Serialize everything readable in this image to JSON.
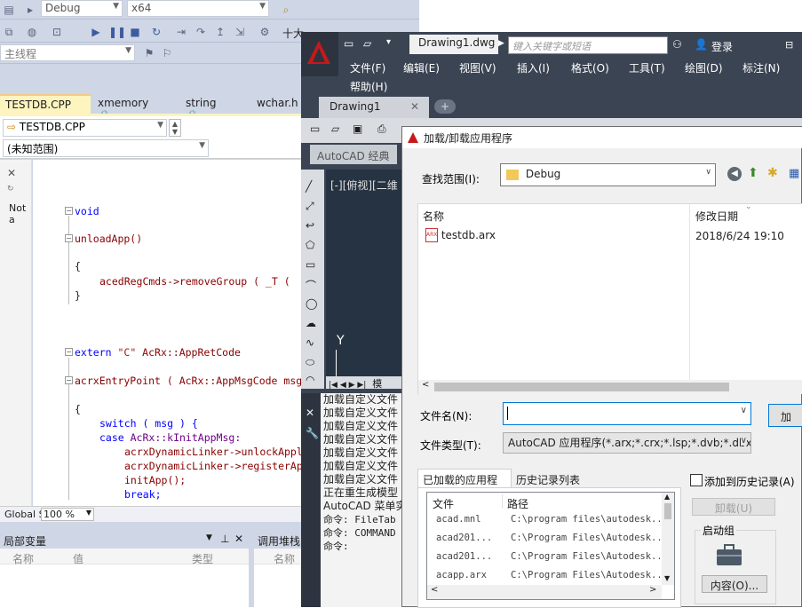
{
  "vs": {
    "toolbar": {
      "config_value": "Debug",
      "platform_value": "x64",
      "thread_label": "主线程",
      "extra_label": "十大"
    },
    "tabs": [
      {
        "label": "TESTDB.CPP",
        "closable": true
      },
      {
        "label": "xmemory",
        "locked": true
      },
      {
        "label": "string",
        "locked": true
      },
      {
        "label": "wchar.h"
      }
    ],
    "file_combo": "TESTDB.CPP",
    "scope_combo": "(未知范围)",
    "left_strip_text": "Not a",
    "code": {
      "l1": "void",
      "l2": "unloadApp()",
      "l3": "{",
      "l4": "acedRegCmds->removeGroup ( _T (",
      "l5": "}",
      "l6a": "extern ",
      "l6b": "\"C\"",
      "l6c": " AcRx::AppRetCode",
      "l7a": "acrxEntryPoint",
      "l7b": " ( AcRx::AppMsgCode msg",
      "l8": "{",
      "l9": "switch ( msg ) {",
      "l10a": "case ",
      "l10b": "AcRx::kInitAppMsg:",
      "l11": "acrxDynamicLinker->unlockApplic",
      "l12": "acrxDynamicLinker->registerAppM",
      "l13": "initApp();",
      "l14": "break;"
    },
    "status": {
      "global_label": "Global S",
      "zoom": "100 %"
    },
    "locals_panel": {
      "title": "局部变量",
      "cols": [
        "名称",
        "值",
        "类型"
      ]
    },
    "callstack_panel": {
      "title": "调用堆栈",
      "cols": [
        "名称"
      ]
    }
  },
  "acad": {
    "file_title": "Drawing1.dwg",
    "search_placeholder": "键入关键字或短语",
    "login": "登录",
    "menu": [
      "文件(F)",
      "编辑(E)",
      "视图(V)",
      "插入(I)",
      "格式(O)",
      "工具(T)",
      "绘图(D)",
      "标注(N)",
      "帮助(H)"
    ],
    "doc_tab": "Drawing1",
    "workspace": "AutoCAD 经典",
    "viewport_label": "[-][俯视][二维",
    "model_tab": "模",
    "cmd_lines": [
      "加载自定义文件",
      "加载自定义文件",
      "加载自定义文件",
      "加载自定义文件",
      "加载自定义文件",
      "加载自定义文件",
      "加载自定义文件",
      "正在重生成模型",
      "AutoCAD 菜单实",
      "命令: FileTab",
      "命令: COMMAND",
      "命令:"
    ]
  },
  "dialog": {
    "title": "加载/卸载应用程序",
    "lookin_label": "查找范围(I):",
    "lookin_value": "Debug",
    "col_name": "名称",
    "col_date": "修改日期",
    "files": [
      {
        "name": "testdb.arx",
        "date": "2018/6/24 19:10"
      }
    ],
    "filename_label": "文件名(N):",
    "filename_value": "",
    "filetype_label": "文件类型(T):",
    "filetype_value": "AutoCAD 应用程序(*.arx;*.crx;*.lsp;*.dvb;*.dbx",
    "load_button": "加",
    "tab_loaded": "已加载的应用程序",
    "tab_history": "历史记录列表",
    "loaded_cols": [
      "文件",
      "路径"
    ],
    "loaded_rows": [
      {
        "file": "acad.mnl",
        "path": "C:\\program files\\autodesk..."
      },
      {
        "file": "acad201...",
        "path": "C:\\Program Files\\Autodesk..."
      },
      {
        "file": "acad201...",
        "path": "C:\\Program Files\\Autodesk..."
      },
      {
        "file": "acapp.arx",
        "path": "C:\\Program Files\\Autodesk..."
      }
    ],
    "add_history": "添加到历史记录(A)",
    "unload_button": "卸载(U)",
    "startup_group": "启动组",
    "contents_button": "内容(O)..."
  },
  "colors": {
    "vs_bg": "#cfd6e5",
    "acad_bg": "#3b4453",
    "acad_red": "#c41a1a",
    "tab_active": "#fdf4bf"
  }
}
